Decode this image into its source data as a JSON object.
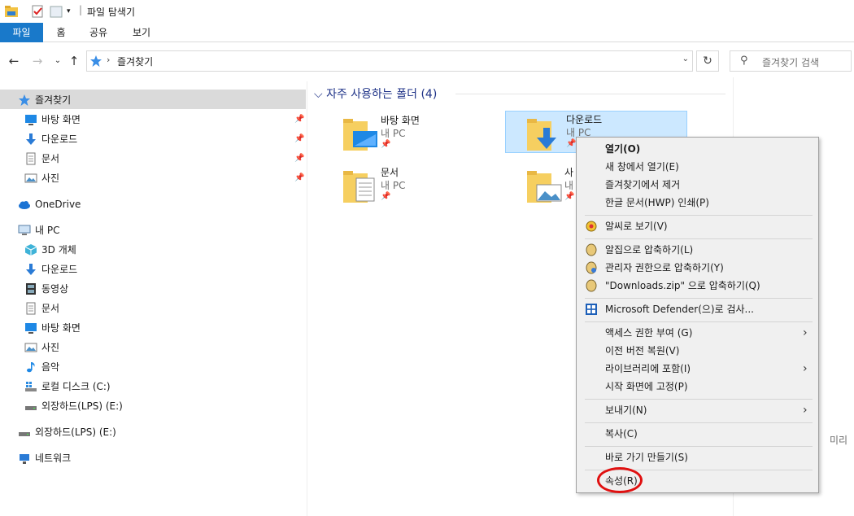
{
  "window": {
    "title": "파일 탐색기"
  },
  "ribbon": {
    "tabs": [
      "파일",
      "홈",
      "공유",
      "보기"
    ]
  },
  "address": {
    "path": "즐겨찾기"
  },
  "search": {
    "placeholder": "즐겨찾기 검색"
  },
  "sidebar": {
    "quick_access": {
      "label": "즐겨찾기",
      "items": [
        "바탕 화면",
        "다운로드",
        "문서",
        "사진"
      ]
    },
    "onedrive": "OneDrive",
    "this_pc": {
      "label": "내 PC",
      "items": [
        "3D 개체",
        "다운로드",
        "동영상",
        "문서",
        "바탕 화면",
        "사진",
        "음악",
        "로컬 디스크 (C:)",
        "외장하드(LPS) (E:)"
      ]
    },
    "external": "외장하드(LPS) (E:)",
    "network": "네트워크"
  },
  "content": {
    "group_title": "자주 사용하는 폴더 (4)",
    "tiles": [
      {
        "name": "바탕 화면",
        "location": "내 PC"
      },
      {
        "name": "다운로드",
        "location": "내 PC"
      },
      {
        "name": "문서",
        "location": "내 PC"
      },
      {
        "name": "사",
        "location": "내"
      }
    ]
  },
  "preview": {
    "label": "미리"
  },
  "context_menu": {
    "items": [
      "열기(O)",
      "새 창에서 열기(E)",
      "즐겨찾기에서 제거",
      "한글 문서(HWP) 인쇄(P)",
      "알씨로 보기(V)",
      "알집으로 압축하기(L)",
      "관리자 권한으로 압축하기(Y)",
      "\"Downloads.zip\" 으로 압축하기(Q)",
      "Microsoft Defender(으)로 검사...",
      "액세스 권한 부여 (G)",
      "이전 버전 복원(V)",
      "라이브러리에 포함(I)",
      "시작 화면에 고정(P)",
      "보내기(N)",
      "복사(C)",
      "바로 가기 만들기(S)",
      "속성(R)"
    ]
  },
  "colors": {
    "accent": "#1979ca",
    "selection": "#cce8ff",
    "highlight_ring": "#e01010"
  }
}
